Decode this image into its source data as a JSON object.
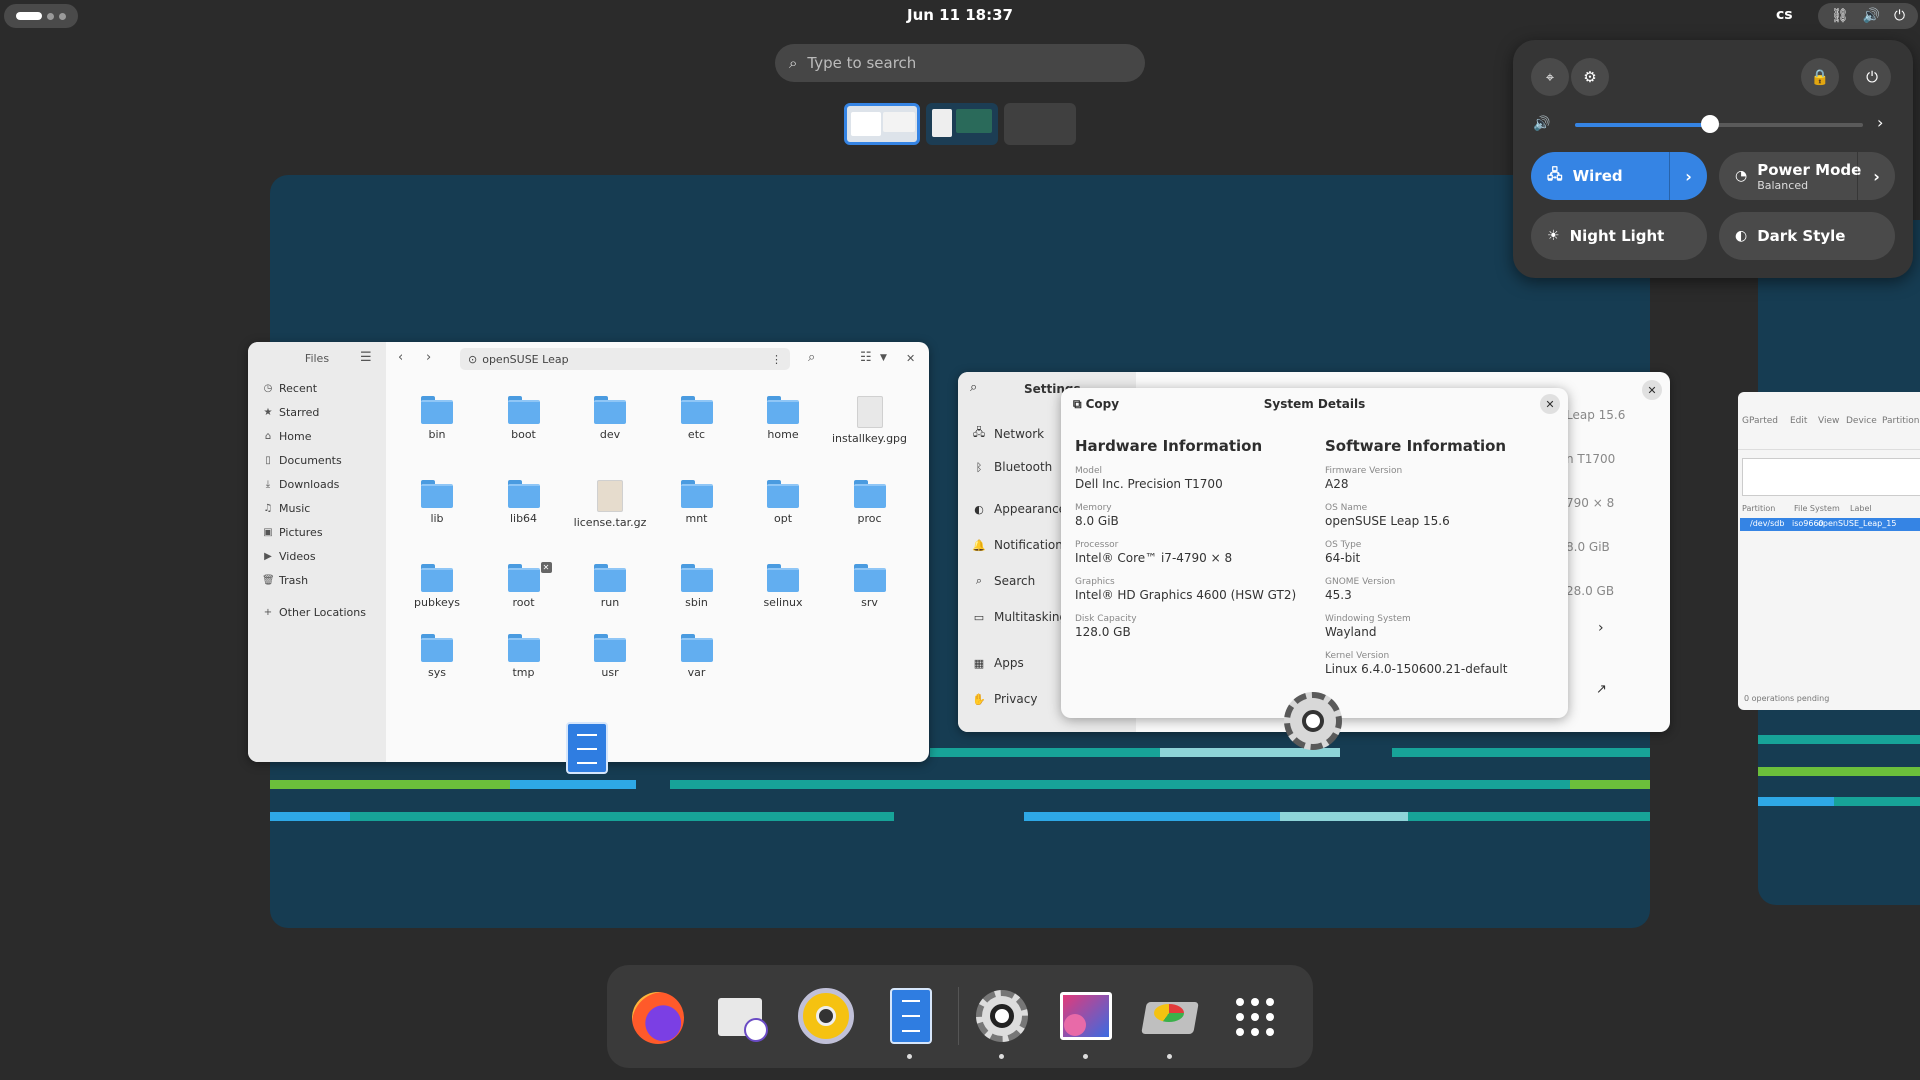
{
  "topbar": {
    "clock": "Jun 11  18:37",
    "language": "cs",
    "status_icons": [
      "network-icon",
      "volume-icon",
      "power-icon"
    ]
  },
  "search": {
    "placeholder": "Type to search"
  },
  "files": {
    "title": "Files",
    "location": "openSUSE Leap",
    "sidebar": [
      {
        "label": "Recent",
        "icon": "clock-icon"
      },
      {
        "label": "Starred",
        "icon": "star-icon"
      },
      {
        "label": "Home",
        "icon": "home-icon"
      },
      {
        "label": "Documents",
        "icon": "document-icon"
      },
      {
        "label": "Downloads",
        "icon": "download-icon"
      },
      {
        "label": "Music",
        "icon": "music-icon"
      },
      {
        "label": "Pictures",
        "icon": "picture-icon"
      },
      {
        "label": "Videos",
        "icon": "video-icon"
      },
      {
        "label": "Trash",
        "icon": "trash-icon"
      },
      {
        "label": "Other Locations",
        "icon": "plus-icon"
      }
    ],
    "items": [
      {
        "name": "bin",
        "type": "folder"
      },
      {
        "name": "boot",
        "type": "folder"
      },
      {
        "name": "dev",
        "type": "folder"
      },
      {
        "name": "etc",
        "type": "folder"
      },
      {
        "name": "home",
        "type": "folder"
      },
      {
        "name": "installkey.gpg",
        "type": "file"
      },
      {
        "name": "lib",
        "type": "folder"
      },
      {
        "name": "lib64",
        "type": "folder"
      },
      {
        "name": "license.tar.gz",
        "type": "archive"
      },
      {
        "name": "mnt",
        "type": "folder"
      },
      {
        "name": "opt",
        "type": "folder"
      },
      {
        "name": "proc",
        "type": "folder"
      },
      {
        "name": "pubkeys",
        "type": "folder"
      },
      {
        "name": "root",
        "type": "folder"
      },
      {
        "name": "run",
        "type": "folder"
      },
      {
        "name": "sbin",
        "type": "folder"
      },
      {
        "name": "selinux",
        "type": "folder"
      },
      {
        "name": "srv",
        "type": "folder"
      },
      {
        "name": "sys",
        "type": "folder"
      },
      {
        "name": "tmp",
        "type": "folder"
      },
      {
        "name": "usr",
        "type": "folder"
      },
      {
        "name": "var",
        "type": "folder"
      }
    ]
  },
  "settings": {
    "title": "Settings",
    "sidebar": [
      {
        "label": "Network",
        "icon": "network-icon"
      },
      {
        "label": "Bluetooth",
        "icon": "bluetooth-icon"
      },
      {
        "label": "Appearance",
        "icon": "appearance-icon"
      },
      {
        "label": "Notifications",
        "icon": "bell-icon"
      },
      {
        "label": "Search",
        "icon": "search-icon"
      },
      {
        "label": "Multitasking",
        "icon": "multitasking-icon"
      },
      {
        "label": "Apps",
        "icon": "apps-icon"
      },
      {
        "label": "Privacy",
        "icon": "hand-icon"
      }
    ],
    "right_values": [
      "Leap 15.6",
      "n T1700",
      "790 × 8",
      "8.0 GiB",
      "28.0 GB"
    ]
  },
  "system_details": {
    "title": "System Details",
    "copy_label": "Copy",
    "hardware_heading": "Hardware Information",
    "software_heading": "Software Information",
    "hardware": [
      {
        "label": "Model",
        "value": "Dell Inc. Precision T1700"
      },
      {
        "label": "Memory",
        "value": "8.0 GiB"
      },
      {
        "label": "Processor",
        "value": "Intel® Core™ i7-4790 × 8"
      },
      {
        "label": "Graphics",
        "value": "Intel® HD Graphics 4600 (HSW GT2)"
      },
      {
        "label": "Disk Capacity",
        "value": "128.0 GB"
      }
    ],
    "software": [
      {
        "label": "Firmware Version",
        "value": "A28"
      },
      {
        "label": "OS Name",
        "value": "openSUSE Leap 15.6"
      },
      {
        "label": "OS Type",
        "value": "64-bit"
      },
      {
        "label": "GNOME Version",
        "value": "45.3"
      },
      {
        "label": "Windowing System",
        "value": "Wayland"
      },
      {
        "label": "Kernel Version",
        "value": "Linux 6.4.0-150600.21-default"
      }
    ]
  },
  "gparted": {
    "menu": [
      "GParted",
      "Edit",
      "View",
      "Device",
      "Partition"
    ],
    "columns": [
      "Partition",
      "File System",
      "Label"
    ],
    "row": [
      "/dev/sdb",
      "iso9660",
      "openSUSE_Leap_15"
    ],
    "status": "0 operations pending"
  },
  "quick_settings": {
    "volume_percent": 47,
    "tiles": [
      {
        "label": "Wired",
        "sub": "",
        "icon": "network-wired-icon",
        "active": true,
        "has_arrow": true
      },
      {
        "label": "Power Mode",
        "sub": "Balanced",
        "icon": "power-mode-icon",
        "active": false,
        "has_arrow": true
      },
      {
        "label": "Night Light",
        "sub": "",
        "icon": "night-light-icon",
        "active": false,
        "has_arrow": false
      },
      {
        "label": "Dark Style",
        "sub": "",
        "icon": "dark-style-icon",
        "active": false,
        "has_arrow": false
      }
    ]
  },
  "dash": {
    "apps": [
      {
        "name": "firefox-icon",
        "running": false
      },
      {
        "name": "evolution-mail-icon",
        "running": false
      },
      {
        "name": "rhythmbox-icon",
        "running": false
      },
      {
        "name": "files-icon",
        "running": true
      },
      {
        "name": "settings-icon",
        "running": true
      },
      {
        "name": "image-viewer-icon",
        "running": true
      },
      {
        "name": "gparted-icon",
        "running": true
      },
      {
        "name": "show-apps-icon",
        "running": false
      }
    ]
  },
  "colors": {
    "accent": "#3584e4",
    "workspace_bg": "#163c52",
    "stripe_green": "#6bbf3b",
    "stripe_blue": "#2ea8e6",
    "stripe_teal": "#17a398",
    "stripe_light": "#8ed4d8"
  }
}
